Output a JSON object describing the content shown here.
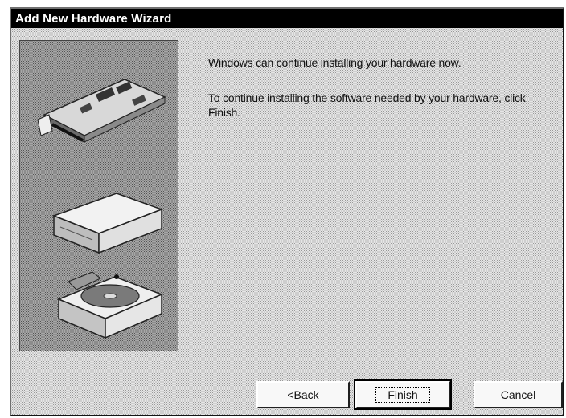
{
  "window": {
    "title": "Add New Hardware Wizard"
  },
  "message": {
    "line1": "Windows can continue installing your hardware now.",
    "line2": "To continue installing the software needed by your hardware, click Finish."
  },
  "buttons": {
    "back_prefix": "< ",
    "back_accel": "B",
    "back_rest": "ack",
    "finish": "Finish",
    "cancel": "Cancel"
  },
  "illustration": {
    "items": [
      "expansion-card-icon",
      "external-drive-icon",
      "cd-rom-drive-icon"
    ]
  }
}
